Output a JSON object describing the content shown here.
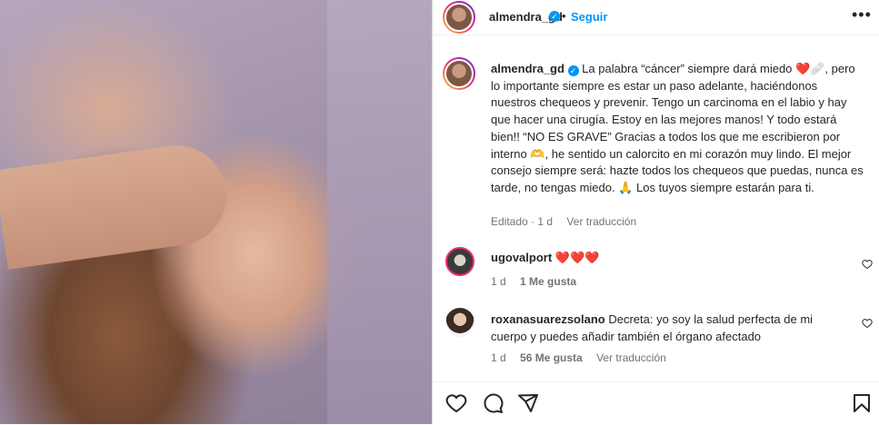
{
  "post": {
    "username": "almendra_gd",
    "follow_label": "Seguir",
    "dot": "•",
    "more": "•••"
  },
  "caption": {
    "username": "almendra_gd",
    "text": "La palabra “cáncer” siempre dará miedo ❤️🩹, pero lo importante siempre es estar un paso adelante, haciéndonos nuestros chequeos y prevenir. Tengo un carcinoma en el labio y hay que hacer una cirugía. Estoy en las mejores manos! Y todo estará bien!! “NO ES GRAVE” Gracias a todos los que me escribieron por interno 🫶, he sentido un calorcito en mi corazón muy lindo. El mejor consejo siempre será: hazte todos los chequeos que puedas, nunca es tarde, no tengas miedo. 🙏 Los tuyos siempre estarán para ti.",
    "edited": "Editado",
    "time": "1 d",
    "translate": "Ver traducción"
  },
  "comments": [
    {
      "username": "ugovalport",
      "text": "❤️❤️❤️",
      "time": "1 d",
      "likes": "1 Me gusta"
    },
    {
      "username": "roxanasuarezsolano",
      "text": "Decreta: yo soy la salud perfecta de mi cuerpo y puedes añadir también el órgano afectado",
      "time": "1 d",
      "likes": "56 Me gusta",
      "translate": "Ver traducción"
    }
  ],
  "colors": {
    "accent": "#0095f6",
    "muted": "#737373",
    "heart": "#ed4956"
  },
  "icons": [
    "verified-icon",
    "more-icon",
    "heart-icon",
    "comment-icon",
    "share-icon",
    "bookmark-icon"
  ]
}
